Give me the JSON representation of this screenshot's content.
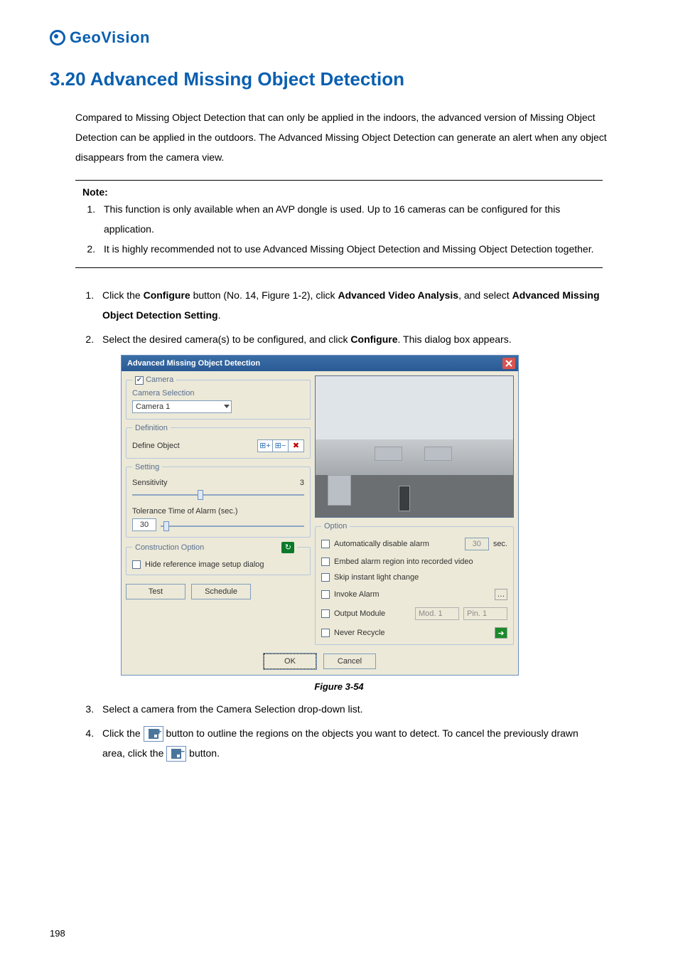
{
  "logo": {
    "text": "GeoVision"
  },
  "heading": "3.20  Advanced Missing Object Detection",
  "intro": "Compared to Missing Object Detection that can only be applied in the indoors, the advanced version of Missing Object Detection can be applied in the outdoors. The Advanced Missing Object Detection can generate an alert when any object disappears from the camera view.",
  "note": {
    "title": "Note:",
    "items": [
      "This function is only available when an AVP dongle is used. Up to 16 cameras can be configured for this application.",
      "It is highly recommended not to use Advanced Missing Object Detection and Missing Object Detection together."
    ]
  },
  "steps": {
    "s1_a": "Click the ",
    "s1_b_bold": "Configure",
    "s1_c": " button (No. 14, Figure 1-2), click ",
    "s1_d_bold": "Advanced Video Analysis",
    "s1_e": ", and select ",
    "s1_f_bold": "Advanced Missing Object Detection Setting",
    "s1_g": ".",
    "s2_a": "Select the desired camera(s) to be configured, and click ",
    "s2_b_bold": "Configure",
    "s2_c": ". This dialog box appears.",
    "s3": "Select a camera from the Camera Selection drop-down list.",
    "s4_a": "Click the ",
    "s4_b": " button to outline the regions on the objects you want to detect. To cancel the previously drawn area, click the ",
    "s4_c": " button."
  },
  "figure_caption": "Figure 3-54",
  "dialog": {
    "title": "Advanced Missing Object Detection",
    "camera_group": "Camera",
    "camera_selection_label": "Camera Selection",
    "camera_value": "Camera 1",
    "definition_group": "Definition",
    "define_object_label": "Define Object",
    "setting_group": "Setting",
    "sensitivity_label": "Sensitivity",
    "sensitivity_value": "3",
    "tolerance_label": "Tolerance Time of Alarm (sec.)",
    "tolerance_value": "30",
    "construction_group": "Construction Option",
    "hide_ref": "Hide reference image setup dialog",
    "test_btn": "Test",
    "schedule_btn": "Schedule",
    "option_group": "Option",
    "auto_disable": "Automatically disable alarm",
    "auto_disable_value": "30",
    "sec_label": "sec.",
    "embed": "Embed alarm region into recorded video",
    "skip": "Skip instant light change",
    "invoke": "Invoke Alarm",
    "output": "Output Module",
    "mod_value": "Mod. 1",
    "pin_value": "Pin. 1",
    "never_recycle": "Never Recycle",
    "ok_btn": "OK",
    "cancel_btn": "Cancel"
  },
  "page_number": "198"
}
